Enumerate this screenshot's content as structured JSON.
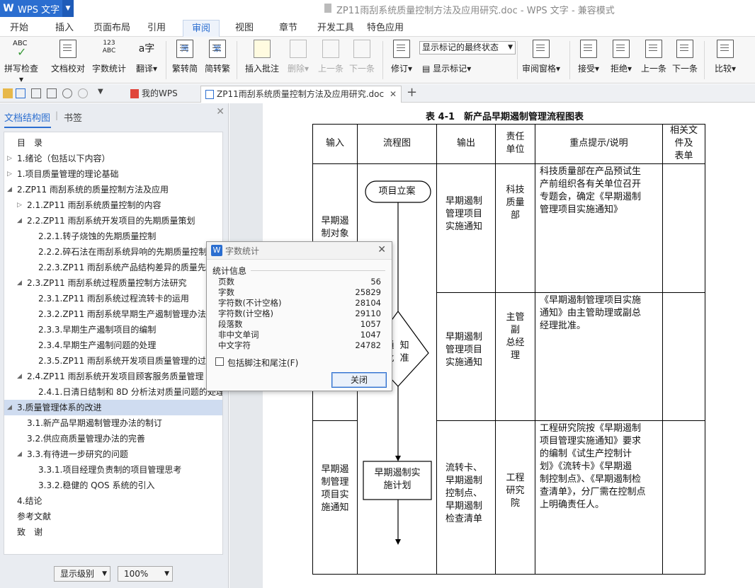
{
  "app": {
    "name": "WPS 文字",
    "logo": "W",
    "window_title": "ZP11雨刮系统质量控制方法及应用研究.doc - WPS 文字 - 兼容模式"
  },
  "menu": {
    "tabs": [
      "开始",
      "插入",
      "页面布局",
      "引用",
      "审阅",
      "视图",
      "章节",
      "开发工具",
      "特色应用"
    ],
    "active": "审阅"
  },
  "ribbon": {
    "spellcheck": "拼写检查",
    "spellcheck_icon": "ABC",
    "doc_proof": "文档校对",
    "word_count": "字数统计",
    "word_count_icon": "123\nABC",
    "translate": "翻译",
    "trad_to_simp": "繁转简",
    "trad_icon": "繁",
    "simp_to_trad": "简转繁",
    "simp_icon": "简",
    "insert_comment": "插入批注",
    "delete": "删除",
    "prev": "上一条",
    "next": "下一条",
    "revise": "修订",
    "show_markup_select": "显示标记的最终状态",
    "show_markup": "显示标记",
    "review_pane": "审阅窗格",
    "accept": "接受",
    "reject": "拒绝",
    "prev2": "上一条",
    "next2": "下一条",
    "compare": "比较"
  },
  "doctabs": {
    "my_wps": "我的WPS",
    "current_doc": "ZP11雨刮系统质量控制方法及应用研究.doc",
    "add": "+"
  },
  "sidebar": {
    "tab_outline": "文档结构图",
    "tab_bookmarks": "书签",
    "items": [
      {
        "label": "目　录",
        "level": 0,
        "toggle": ""
      },
      {
        "label": "1.绪论（包括以下内容）",
        "level": 0,
        "toggle": "▷"
      },
      {
        "label": "1.项目质量管理的理论基础",
        "level": 0,
        "toggle": "▷"
      },
      {
        "label": "2.ZP11 雨刮系统的质量控制方法及应用",
        "level": 0,
        "toggle": "◢"
      },
      {
        "label": "2.1.ZP11 雨刮系统质量控制的内容",
        "level": 1,
        "toggle": "▷"
      },
      {
        "label": "2.2.ZP11 雨刮系统开发项目的先期质量策划",
        "level": 1,
        "toggle": "◢"
      },
      {
        "label": "2.2.1.转子烧蚀的先期质量控制",
        "level": 2,
        "toggle": ""
      },
      {
        "label": "2.2.2.碎石法在雨刮系统异响的先期质量控制",
        "level": 2,
        "toggle": ""
      },
      {
        "label": "2.2.3.ZP11 雨刮系统产品结构差异的质量先期控制",
        "level": 2,
        "toggle": ""
      },
      {
        "label": "2.3.ZP11 雨刮系统过程质量控制方法研究",
        "level": 1,
        "toggle": "◢"
      },
      {
        "label": "2.3.1.ZP11 雨刮系统过程流转卡的运用",
        "level": 2,
        "toggle": ""
      },
      {
        "label": "2.3.2.ZP11 雨刮系统早期生产遏制管理办法",
        "level": 2,
        "toggle": ""
      },
      {
        "label": "2.3.3.早期生产遏制项目的编制",
        "level": 2,
        "toggle": ""
      },
      {
        "label": "2.3.4.早期生产遏制问题的处理",
        "level": 2,
        "toggle": ""
      },
      {
        "label": "2.3.5.ZP11 雨刮系统开发项目质量管理的过程",
        "level": 2,
        "toggle": ""
      },
      {
        "label": "2.4.ZP11 雨刮系统开发项目顾客服务质量管理",
        "level": 1,
        "toggle": "◢"
      },
      {
        "label": "2.4.1.日清日结制和 8D 分析法对质量问题的处理",
        "level": 2,
        "toggle": ""
      },
      {
        "label": "3.质量管理体系的改进",
        "level": 0,
        "toggle": "◢"
      },
      {
        "label": "3.1.新产品早期遏制管理办法的制订",
        "level": 1,
        "toggle": ""
      },
      {
        "label": "3.2.供应商质量管理办法的完善",
        "level": 1,
        "toggle": ""
      },
      {
        "label": "3.3.有待进一步研究的问题",
        "level": 1,
        "toggle": "◢"
      },
      {
        "label": "3.3.1.项目经理负责制的项目管理思考",
        "level": 2,
        "toggle": ""
      },
      {
        "label": "3.3.2.稳健的 QOS 系统的引入",
        "level": 2,
        "toggle": ""
      },
      {
        "label": "4.结论",
        "level": 0,
        "toggle": ""
      },
      {
        "label": "参考文献",
        "level": 0,
        "toggle": ""
      },
      {
        "label": "致　谢",
        "level": 0,
        "toggle": ""
      }
    ],
    "selected_index": 17,
    "display_level": "显示级别",
    "zoom": "100%"
  },
  "document": {
    "table_title": "表 4-1　新产品早期遏制管理流程图表",
    "headers": [
      "输入",
      "流程图",
      "输出",
      "责任\n单位",
      "重点提示/说明",
      "相关文\n件及\n表单"
    ],
    "rows": [
      {
        "input": "早期遏\n制对象",
        "flow_box": "项目立案",
        "output": "早期遏制\n管理项目\n实施通知",
        "unit": "科技\n质量\n部",
        "note": "科技质量部在产品预试生\n产前组织各有关单位召开\n专题会，确定《早期遏制\n管理项目实施通知》"
      },
      {
        "input": "",
        "flow_box": "通  知\n批  准",
        "output": "早期遏制\n管理项目\n实施通知",
        "unit": "主管\n副\n总经\n理",
        "note": "《早期遏制管理项目实施\n通知》由主管助理或副总\n经理批准。"
      },
      {
        "input": "早期遏\n制管理\n项目实\n施通知",
        "flow_box": "早期遏制实\n施计划",
        "output": "流转卡、\n早期遏制\n控制点、\n早期遏制\n检查清单",
        "unit": "工程\n研究\n院",
        "note": "工程研究院按《早期遏制\n项目管理实施通知》要求\n的编制《试生产控制计\n划》《流转卡》《早期遏\n制控制点》、《早期遏制检\n查清单》，分厂需在控制点\n上明确责任人。"
      }
    ]
  },
  "dialog": {
    "title": "字数统计",
    "group": "统计信息",
    "stats": [
      {
        "label": "页数",
        "value": "56"
      },
      {
        "label": "字数",
        "value": "25829"
      },
      {
        "label": "字符数(不计空格)",
        "value": "28104"
      },
      {
        "label": "字符数(计空格)",
        "value": "29110"
      },
      {
        "label": "段落数",
        "value": "1057"
      },
      {
        "label": "非中文单词",
        "value": "1047"
      },
      {
        "label": "中文字符",
        "value": "24782"
      }
    ],
    "include_footnotes": "包括脚注和尾注(F)",
    "close": "关闭"
  },
  "colors": {
    "accent": "#2b6ed0",
    "selected": "#cfdcf0"
  }
}
